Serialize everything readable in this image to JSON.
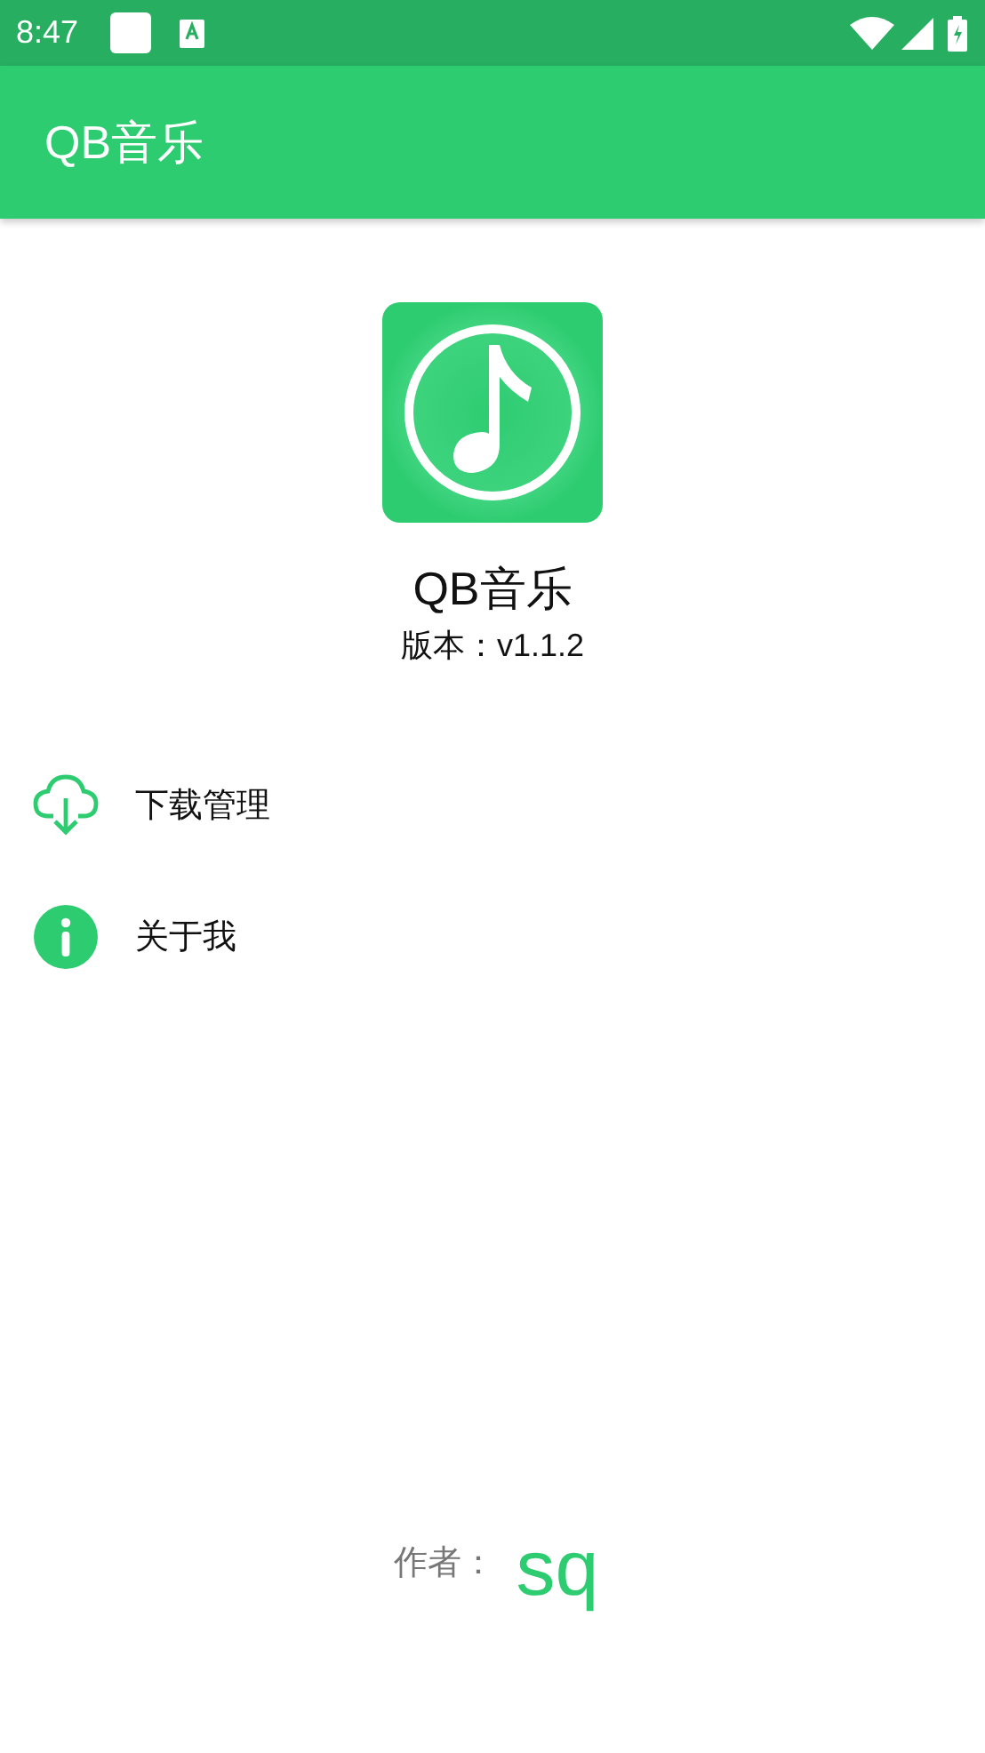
{
  "status_bar": {
    "time": "8:47"
  },
  "app_bar": {
    "title": "QB音乐"
  },
  "app_info": {
    "name": "QB音乐",
    "version": "版本：v1.1.2"
  },
  "menu": [
    {
      "kind": "download",
      "label": "下载管理"
    },
    {
      "kind": "info",
      "label": "关于我"
    }
  ],
  "footer": {
    "label": "作者：",
    "author": "sq"
  }
}
